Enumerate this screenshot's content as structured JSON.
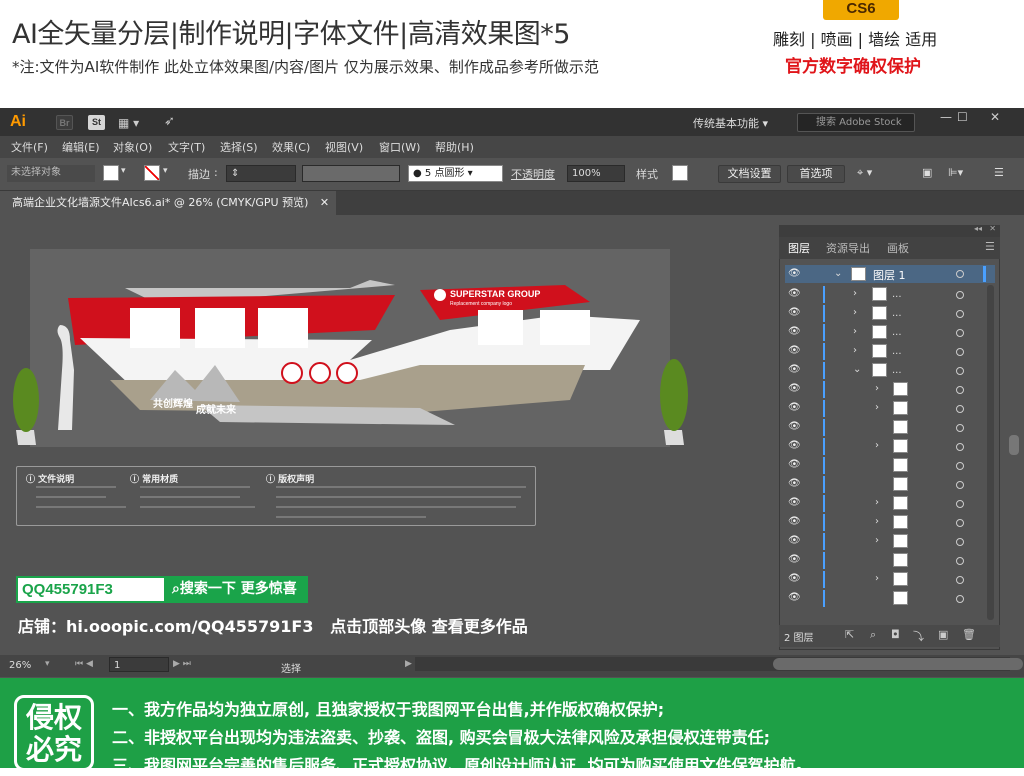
{
  "header": {
    "title": "AI全矢量分层|制作说明|字体文件|高清效果图*5",
    "note": "*注:文件为AI软件制作 此处立体效果图/内容/图片 仅为展示效果、制作成品参考所做示范",
    "cs6_badge": "CS6",
    "usage": "雕刻 | 喷画 | 墙绘 适用",
    "protection": "官方数字确权保护"
  },
  "app": {
    "logo": "Ai",
    "bridge": "Br",
    "stock": "St",
    "workspace": "传统基本功能",
    "stock_search_placeholder": "搜索 Adobe Stock",
    "menus": [
      "文件(F)",
      "编辑(E)",
      "对象(O)",
      "文字(T)",
      "选择(S)",
      "效果(C)",
      "视图(V)",
      "窗口(W)",
      "帮助(H)"
    ],
    "control": {
      "no_selection": "未选择对象",
      "stroke_label": "描边",
      "brush": "5 点圆形",
      "opacity_label": "不透明度",
      "opacity_value": "100%",
      "style_label": "样式",
      "doc_setup": "文档设置",
      "prefs": "首选项"
    },
    "doc_tab": "高端企业文化墙源文件AIcs6.ai* @ 26% (CMYK/GPU 预览)",
    "status": {
      "zoom": "26%",
      "page": "1",
      "tool": "选择"
    }
  },
  "artwork": {
    "company": "SUPERSTAR GROUP",
    "company_sub": "Replacement company logo",
    "slogan1": "共创辉煌",
    "slogan2": "成就未来",
    "spec_headings": [
      "文件说明",
      "常用材质",
      "版权声明"
    ]
  },
  "layers_panel": {
    "tabs": [
      "图层",
      "资源导出",
      "画板"
    ],
    "top_layer": "图层 1",
    "sublayer_label": "...",
    "footer_count": "2 图层"
  },
  "promo": {
    "qq": "QQ455791F3",
    "search_btn": "搜索一下 更多惊喜",
    "shop": "店铺：hi.ooopic.com/QQ455791F3",
    "shop_tail": "点击顶部头像 查看更多作品"
  },
  "footer": {
    "seal": "侵权必究",
    "lines": [
      "一、我方作品均为独立原创, 且独家授权于我图网平台出售,并作版权确权保护;",
      "二、非授权平台出现均为违法盗卖、抄袭、盗图, 购买会冒极大法律风险及承担侵权连带责任;",
      "三、我图网平台完善的售后服务、正式授权协议、原创设计师认证, 均可为购买使用文件保驾护航。"
    ]
  },
  "colors": {
    "accent_red": "#d0101c",
    "green": "#1ea046",
    "ai_orange": "#ff9a00"
  }
}
